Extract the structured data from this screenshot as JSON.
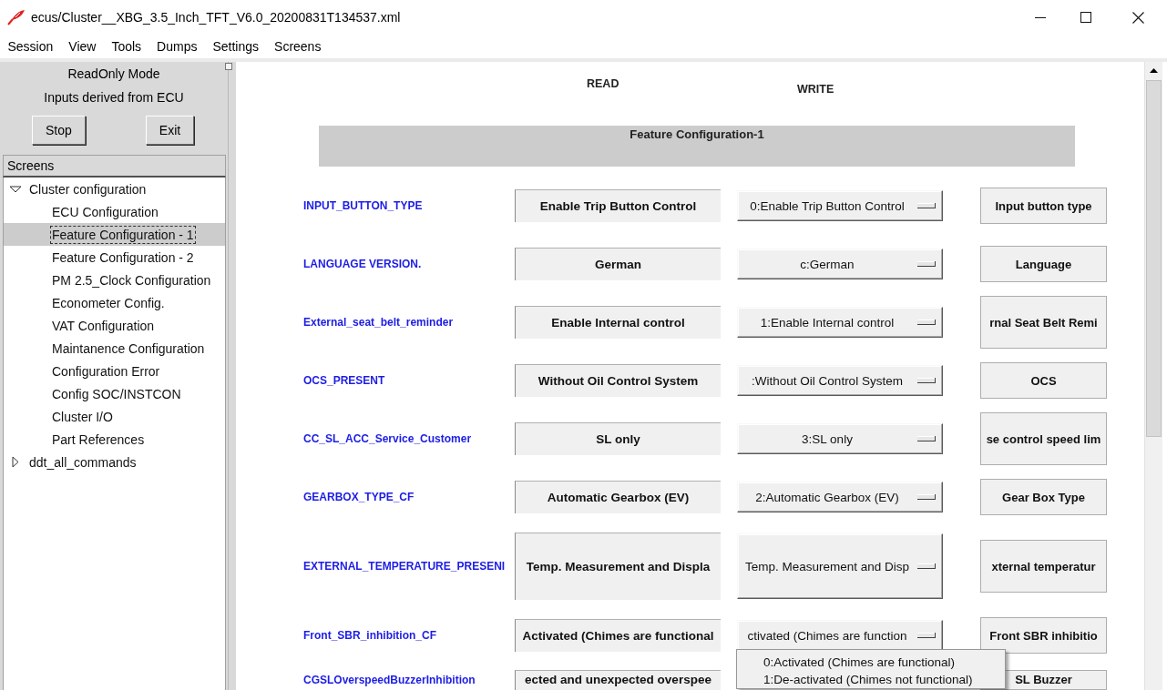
{
  "window": {
    "title": "ecus/Cluster__XBG_3.5_Inch_TFT_V6.0_20200831T134537.xml"
  },
  "menu_bar": [
    "Session",
    "View",
    "Tools",
    "Dumps",
    "Settings",
    "Screens"
  ],
  "sidebar": {
    "mode": "ReadOnly Mode",
    "info": "Inputs derived from ECU",
    "buttons": [
      "Stop",
      "Exit"
    ],
    "tree_header": "Screens",
    "tree": [
      {
        "label": "Cluster configuration",
        "expanded": true,
        "selected": false,
        "children": [
          {
            "label": "ECU Configuration",
            "selected": false
          },
          {
            "label": "Feature Configuration - 1",
            "selected": true
          },
          {
            "label": "Feature Configuration - 2",
            "selected": false
          },
          {
            "label": "PM 2.5_Clock Configuration",
            "selected": false
          },
          {
            "label": "Econometer Config.",
            "selected": false
          },
          {
            "label": "VAT Configuration",
            "selected": false
          },
          {
            "label": "Maintanence Configuration",
            "selected": false
          },
          {
            "label": "Configuration Error",
            "selected": false
          },
          {
            "label": "Config SOC/INSTCON",
            "selected": false
          },
          {
            "label": "Cluster I/O",
            "selected": false
          },
          {
            "label": "Part References",
            "selected": false
          }
        ]
      },
      {
        "label": "ddt_all_commands",
        "expanded": false,
        "selected": false
      }
    ]
  },
  "screen": {
    "column_headings": [
      "READ",
      "WRITE"
    ],
    "section_title": "Feature Configuration-1",
    "rows": [
      {
        "label": "INPUT_BUTTON_TYPE",
        "read_value": "Enable Trip Button Control",
        "write_value": "0:Enable Trip Button Control",
        "button": "Input button type"
      },
      {
        "label": "LANGUAGE VERSION.",
        "read_value": "German",
        "write_value": "c:German",
        "button": "Language"
      },
      {
        "label": "External_seat_belt_reminder",
        "read_value": "Enable Internal control",
        "write_value": "1:Enable Internal control",
        "button": "rnal Seat Belt Remi"
      },
      {
        "label": "OCS_PRESENT",
        "read_value": "Without Oil Control System",
        "write_value": ":Without Oil Control System",
        "button": "OCS"
      },
      {
        "label": "CC_SL_ACC_Service_Customer",
        "read_value": "SL only",
        "write_value": "3:SL only",
        "button": "se control speed lim"
      },
      {
        "label": "GEARBOX_TYPE_CF",
        "read_value": "Automatic Gearbox (EV)",
        "write_value": "2:Automatic Gearbox (EV)",
        "button": "Gear Box Type"
      },
      {
        "label": "EXTERNAL_TEMPERATURE_PRESENI",
        "read_value": "Temp. Measurement and Displa",
        "write_value": "Temp. Measurement and Disp",
        "button": "xternal temperatur"
      },
      {
        "label": "Front_SBR_inhibition_CF",
        "read_value": "Activated (Chimes are functional",
        "write_value": "ctivated (Chimes are function",
        "button": "Front SBR inhibitio",
        "menu": {
          "items": [
            {
              "label": "0:Activated (Chimes are functional)",
              "selected": false
            },
            {
              "label": "1:De-activated (Chimes not functional)",
              "selected": false
            }
          ]
        }
      },
      {
        "label": "CGSLOverspeedBuzzerInhibition",
        "read_value": "ected and unexpected overspee",
        "button": "SL Buzzer"
      }
    ]
  }
}
